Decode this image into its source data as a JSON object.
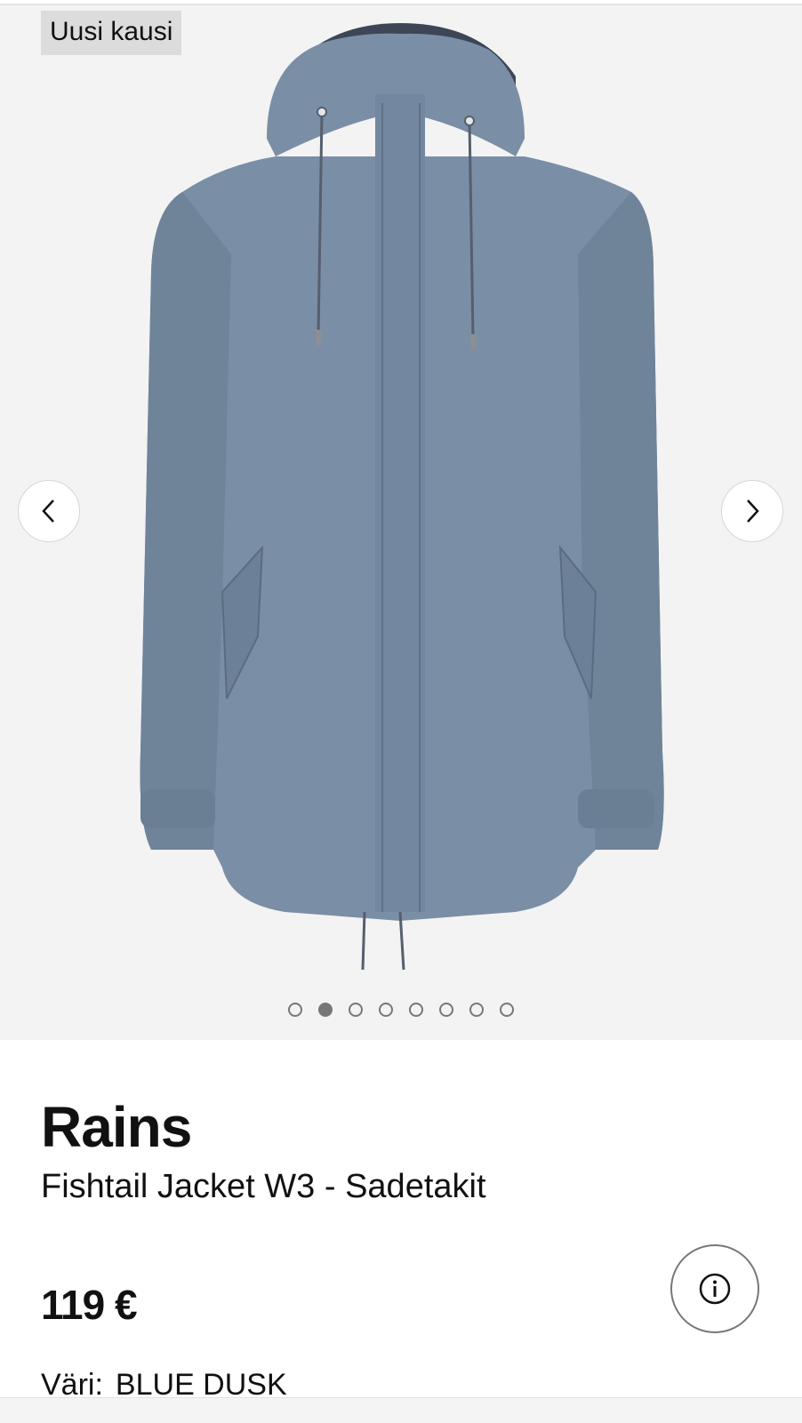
{
  "gallery": {
    "badge": "Uusi kausi",
    "prev_icon": "chevron-left-icon",
    "next_icon": "chevron-right-icon",
    "slide_count": 8,
    "active_slide": 2,
    "image": "jacket-front"
  },
  "product": {
    "brand": "Rains",
    "name": "Fishtail Jacket W3 - Sadetakit",
    "price": "119 €",
    "info_icon": "info-icon",
    "color_label": "Väri:",
    "color_value": "BLUE DUSK"
  },
  "colors": {
    "jacket": "#7a8ea5",
    "gallery_bg": "#f3f3f3"
  }
}
